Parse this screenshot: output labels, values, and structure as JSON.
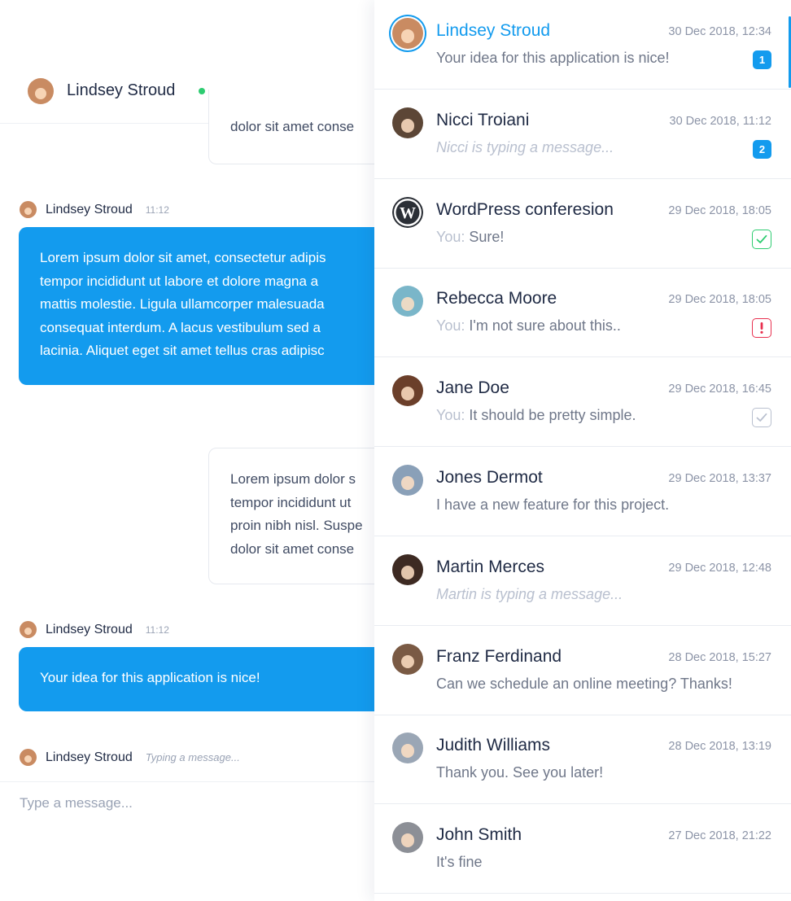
{
  "chat": {
    "header": {
      "name": "Lindsey Stroud",
      "status": "online",
      "status_color": "#2ecc71"
    },
    "messages": [
      {
        "type": "outgoing",
        "lines": [
          "dolor sit amet conse"
        ]
      },
      {
        "type": "incoming",
        "sender": "Lindsey Stroud",
        "time": "11:12",
        "lines": [
          "Lorem ipsum dolor sit amet, consectetur adipis",
          "tempor incididunt ut labore et dolore magna a",
          "mattis molestie. Ligula ullamcorper malesuada",
          "consequat interdum. A lacus vestibulum sed a",
          "lacinia. Aliquet eget sit amet tellus cras adipisc"
        ]
      },
      {
        "type": "outgoing",
        "lines": [
          "Lorem ipsum dolor s",
          "tempor incididunt ut",
          "proin nibh nisl. Suspe",
          "dolor sit amet conse"
        ]
      },
      {
        "type": "incoming",
        "sender": "Lindsey Stroud",
        "time": "11:12",
        "lines": [
          "Your idea for this application is nice!"
        ]
      }
    ],
    "typing_row": {
      "sender": "Lindsey Stroud",
      "label": "Typing a message..."
    },
    "composer": {
      "placeholder": "Type a message..."
    },
    "accent_color": "#139bee"
  },
  "conversations": [
    {
      "name": "Lindsey Stroud",
      "date": "30 Dec 2018, 12:34",
      "message": "Your idea for this application is nice!",
      "you": false,
      "typing": false,
      "indicator": {
        "type": "badge",
        "value": "1"
      },
      "active": true,
      "avatar": "#c98b62"
    },
    {
      "name": "Nicci Troiani",
      "date": "30 Dec 2018, 11:12",
      "message": "Nicci is typing a message...",
      "you": false,
      "typing": true,
      "indicator": {
        "type": "badge",
        "value": "2"
      },
      "active": false,
      "avatar": "#5c4636"
    },
    {
      "name": "WordPress conferesion",
      "date": "29 Dec 2018, 18:05",
      "message": "Sure!",
      "you": true,
      "typing": false,
      "indicator": {
        "type": "check",
        "color": "#2ecc71"
      },
      "active": false,
      "avatar": "wordpress"
    },
    {
      "name": "Rebecca Moore",
      "date": "29 Dec 2018, 18:05",
      "message": "I'm not sure about this..",
      "you": true,
      "typing": false,
      "indicator": {
        "type": "alert",
        "color": "#e8304f"
      },
      "active": false,
      "avatar": "#7ab6c9"
    },
    {
      "name": "Jane Doe",
      "date": "29 Dec 2018, 16:45",
      "message": "It should be pretty simple.",
      "you": true,
      "typing": false,
      "indicator": {
        "type": "check",
        "color": "#b9c0cf"
      },
      "active": false,
      "avatar": "#6b3f2a"
    },
    {
      "name": "Jones Dermot",
      "date": "29 Dec 2018, 13:37",
      "message": "I have a new feature for this project.",
      "you": false,
      "typing": false,
      "indicator": null,
      "active": false,
      "avatar": "#8aa0b8"
    },
    {
      "name": "Martin Merces",
      "date": "29 Dec 2018, 12:48",
      "message": "Martin is typing a message...",
      "you": false,
      "typing": true,
      "indicator": null,
      "active": false,
      "avatar": "#3d2a22"
    },
    {
      "name": "Franz Ferdinand",
      "date": "28 Dec 2018, 15:27",
      "message": "Can we schedule an online meeting? Thanks!",
      "you": false,
      "typing": false,
      "indicator": null,
      "active": false,
      "avatar": "#7a5a44"
    },
    {
      "name": "Judith Williams",
      "date": "28 Dec 2018, 13:19",
      "message": "Thank you. See you later!",
      "you": false,
      "typing": false,
      "indicator": null,
      "active": false,
      "avatar": "#9aa6b5"
    },
    {
      "name": "John Smith",
      "date": "27 Dec 2018, 21:22",
      "message": "It's fine",
      "you": false,
      "typing": false,
      "indicator": null,
      "active": false,
      "avatar": "#8c8f96"
    }
  ],
  "you_label": "You:"
}
